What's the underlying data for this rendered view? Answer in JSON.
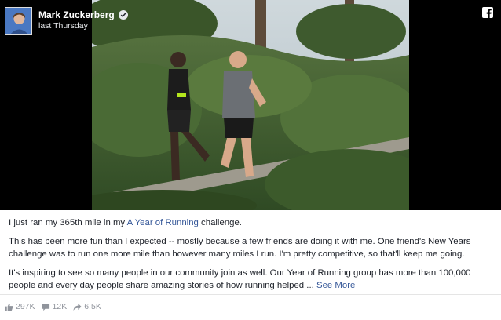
{
  "post": {
    "author": "Mark Zuckerberg",
    "timestamp": "last Thursday",
    "body": {
      "line1_before": "I just ran my 365th mile in my ",
      "line1_link": "A Year of Running",
      "line1_after": " challenge.",
      "para2": "This has been more fun than I expected -- mostly because a few friends are doing it with me. One friend's New Years challenge was to run one more mile than however many miles I run. I'm pretty competitive, so that'll keep me going.",
      "para3": "It's inspiring to see so many people in our community join as well. Our Year of Running group has more than 100,000 people and every day people share amazing stories of how running helped ...",
      "see_more": "See More"
    },
    "stats": {
      "reactions": "297K",
      "comments": "12K",
      "shares": "6.5K"
    }
  },
  "icons": {
    "verified": "verified-badge-icon",
    "facebook": "facebook-logo-icon",
    "like": "like-icon",
    "comment": "comment-icon",
    "share": "share-icon"
  },
  "colors": {
    "link": "#365899",
    "text": "#1d2129",
    "meta": "#90949c"
  }
}
